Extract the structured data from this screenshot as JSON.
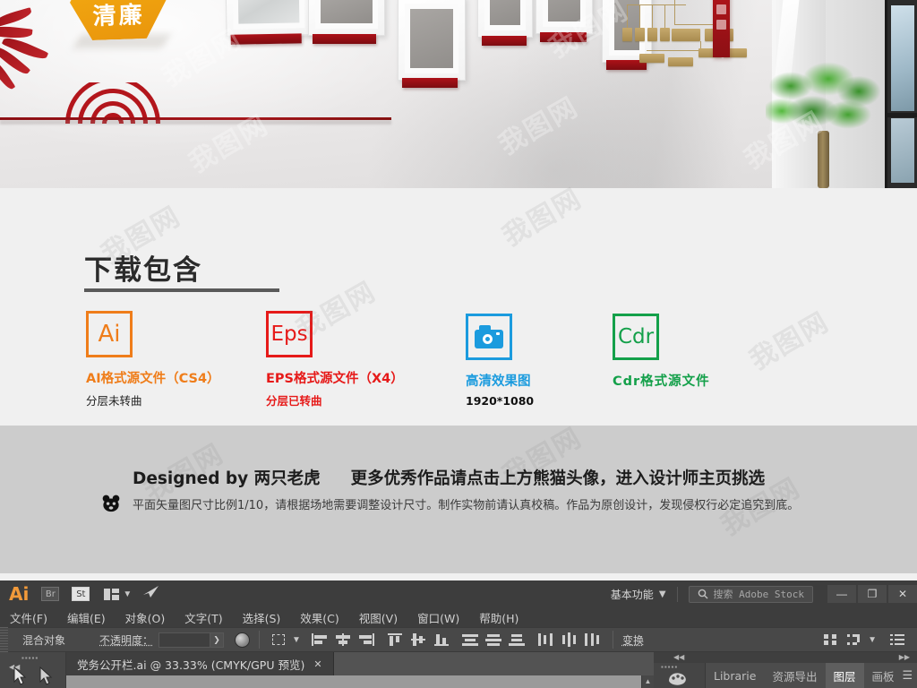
{
  "preview": {
    "hex_badge_text": "清廉",
    "alt": "办公室党建文化墙效果图",
    "watermarks": [
      "我图网",
      "我图网",
      "我图网",
      "我图网",
      "我图网"
    ]
  },
  "download": {
    "title": "下载包含",
    "formats": [
      {
        "icon": "ai-file-icon",
        "badge": "Ai",
        "label": "AI格式源文件（CS4）",
        "sub": "分层未转曲",
        "color": "#ef7d1a",
        "sub_color": "#222222"
      },
      {
        "icon": "eps-file-icon",
        "badge": "Eps",
        "label": "EPS格式源文件（X4）",
        "sub": "分层已转曲",
        "color": "#e61a19",
        "sub_color": "#e61a19"
      },
      {
        "icon": "camera-icon",
        "badge": "",
        "label": "高清效果图",
        "sub": "1920*1080",
        "color": "#1b9bde",
        "sub_color": "#111111"
      },
      {
        "icon": "cdr-file-icon",
        "badge": "Cdr",
        "label": "Cdr格式源文件",
        "sub": "",
        "color": "#14a04a",
        "sub_color": "#14a04a"
      }
    ]
  },
  "credit": {
    "icon": "panda-head-icon",
    "designed_by": "Designed by 两只老虎",
    "promo": "更多优秀作品请点击上方熊猫头像，进入设计师主页挑选",
    "disclaimer": "平面矢量图尺寸比例1/10，请根据场地需要调整设计尺寸。制作实物前请认真校稿。作品为原创设计，发现侵权行必定追究到底。"
  },
  "illustrator": {
    "app_logo": "Ai",
    "bridge_button": "Br",
    "stock_button": "St",
    "arrange_icon": "arrange-documents-icon",
    "chevron_icon": "chevron-down-icon",
    "rocket_icon": "rocket-icon",
    "workspace": "基本功能",
    "search_icon": "search-icon",
    "search_placeholder": "搜索 Adobe Stock",
    "window_minimize": "—",
    "window_restore": "❐",
    "window_close": "✕",
    "menus": [
      "文件(F)",
      "编辑(E)",
      "对象(O)",
      "文字(T)",
      "选择(S)",
      "效果(C)",
      "视图(V)",
      "窗口(W)",
      "帮助(H)"
    ],
    "control_bar": {
      "object_label": "混合对象",
      "opacity_label": "不透明度：",
      "opacity_value": "",
      "opacity_arrow": "❯",
      "transform_label": "变换",
      "align_icons": [
        "align-selection-icon",
        "align-left-icon",
        "align-horizontal-center-icon",
        "align-right-icon",
        "align-top-icon",
        "align-vertical-center-icon",
        "align-bottom-icon",
        "distribute-top-icon",
        "distribute-vertical-center-icon",
        "distribute-bottom-icon",
        "distribute-left-icon",
        "distribute-horizontal-center-icon",
        "distribute-right-icon"
      ],
      "right_icons": [
        "distribute-spacing-icon",
        "shape-builder-icon",
        "chevron-down-icon",
        "panel-menu-icon"
      ]
    },
    "document_tab": {
      "title": "党务公开栏.ai @ 33.33% (CMYK/GPU 预览)",
      "close_icon": "✕"
    },
    "right_panel": {
      "collapse_left_icon": "◀◀",
      "collapse_right_icon": "▶▶",
      "swatch_icon": "swatches-icon",
      "tabs": [
        {
          "label": "Librarie",
          "active": false
        },
        {
          "label": "资源导出",
          "active": false
        },
        {
          "label": "图层",
          "active": true
        },
        {
          "label": "画板",
          "active": false
        }
      ],
      "panel_menu_icon": "panel-menu-icon"
    },
    "tool_panel": {
      "selection_tool_icon": "selection-arrow-icon",
      "direct_selection_tool_icon": "direct-selection-arrow-icon",
      "collapse_icon": "◀◀"
    }
  }
}
